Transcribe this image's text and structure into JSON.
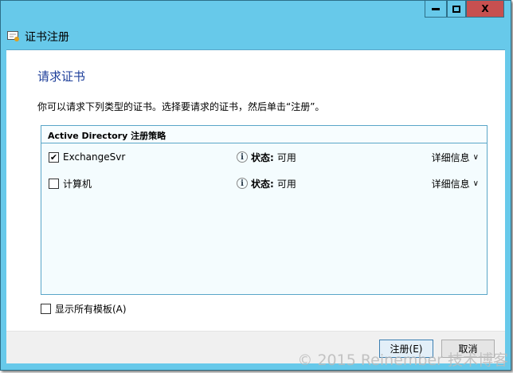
{
  "window": {
    "title": "证书注册",
    "controls": {
      "minimize": "▬",
      "maximize": "□",
      "close": "X"
    }
  },
  "page": {
    "heading": "请求证书",
    "description": "你可以请求下列类型的证书。选择要请求的证书，然后单击“注册”。"
  },
  "policy": {
    "header": "Active Directory 注册策略",
    "items": [
      {
        "name": "ExchangeSvr",
        "checked": true,
        "status_label": "状态:",
        "status": "可用",
        "details": "详细信息"
      },
      {
        "name": "计算机",
        "checked": false,
        "status_label": "状态:",
        "status": "可用",
        "details": "详细信息"
      }
    ]
  },
  "show_all": {
    "label": "显示所有模板(A)",
    "checked": false
  },
  "buttons": {
    "enroll": "注册(E)",
    "cancel": "取消"
  },
  "watermark": "© 2015 Reinember 技术博客",
  "icons": {
    "check": "✔",
    "info": "i",
    "chevron": "⌄"
  }
}
